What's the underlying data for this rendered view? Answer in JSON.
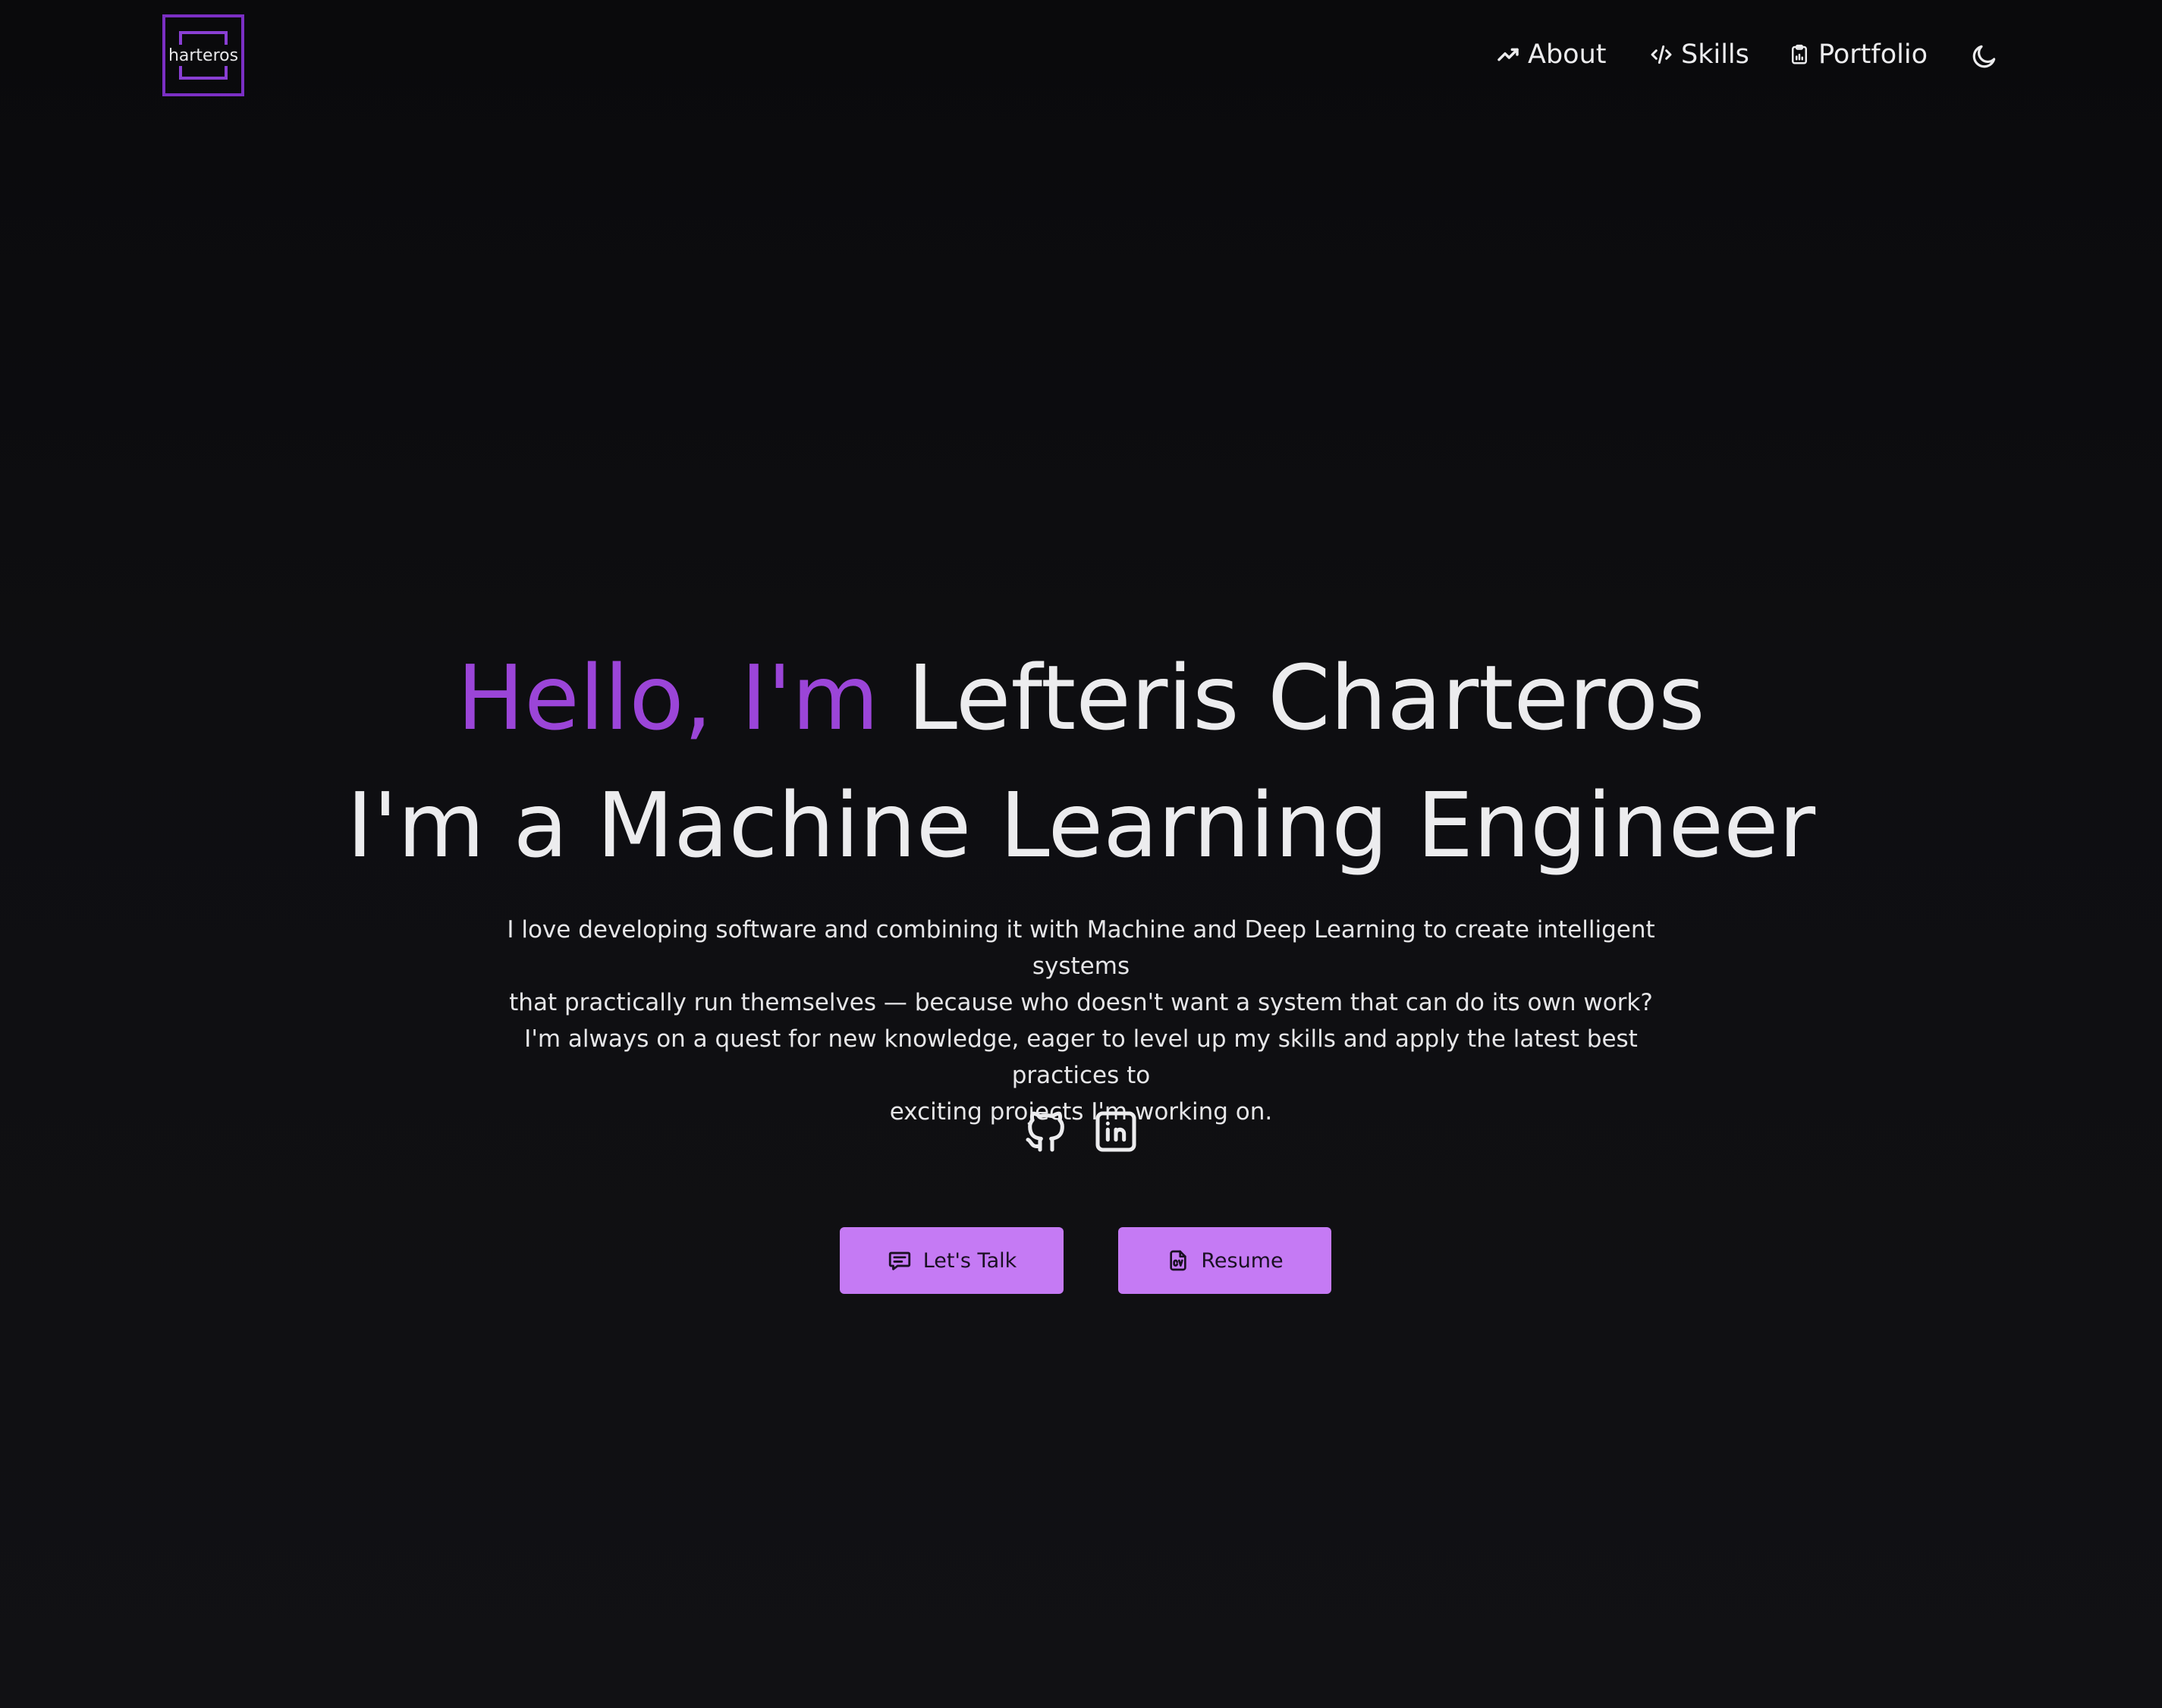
{
  "header": {
    "logo_text": "harteros",
    "nav": [
      {
        "label": "About",
        "icon": "trending-up-icon"
      },
      {
        "label": "Skills",
        "icon": "code-icon"
      },
      {
        "label": "Portfolio",
        "icon": "clipboard-icon"
      }
    ],
    "theme_toggle_icon": "moon-icon"
  },
  "hero": {
    "greeting": "Hello, I'm",
    "name": "Lefteris Charteros",
    "headline": "I'm a Machine Learning Engineer",
    "description": [
      "I love developing software and combining it with Machine and Deep Learning to create intelligent systems",
      "that practically run themselves — because who doesn't want a system that can do its own work?",
      "I'm always on a quest for new knowledge, eager to level up my skills and apply the latest best practices to",
      "exciting projects I'm working on."
    ]
  },
  "socials": [
    {
      "icon": "github-icon"
    },
    {
      "icon": "linkedin-icon"
    }
  ],
  "ctas": {
    "talk_label": "Let's Talk",
    "resume_label": "Resume"
  },
  "colors": {
    "background": "#0d0d10",
    "accent": "#9b45d8",
    "button": "#c57af4",
    "logo_border": "#7b2fc4",
    "text": "#ececee"
  }
}
